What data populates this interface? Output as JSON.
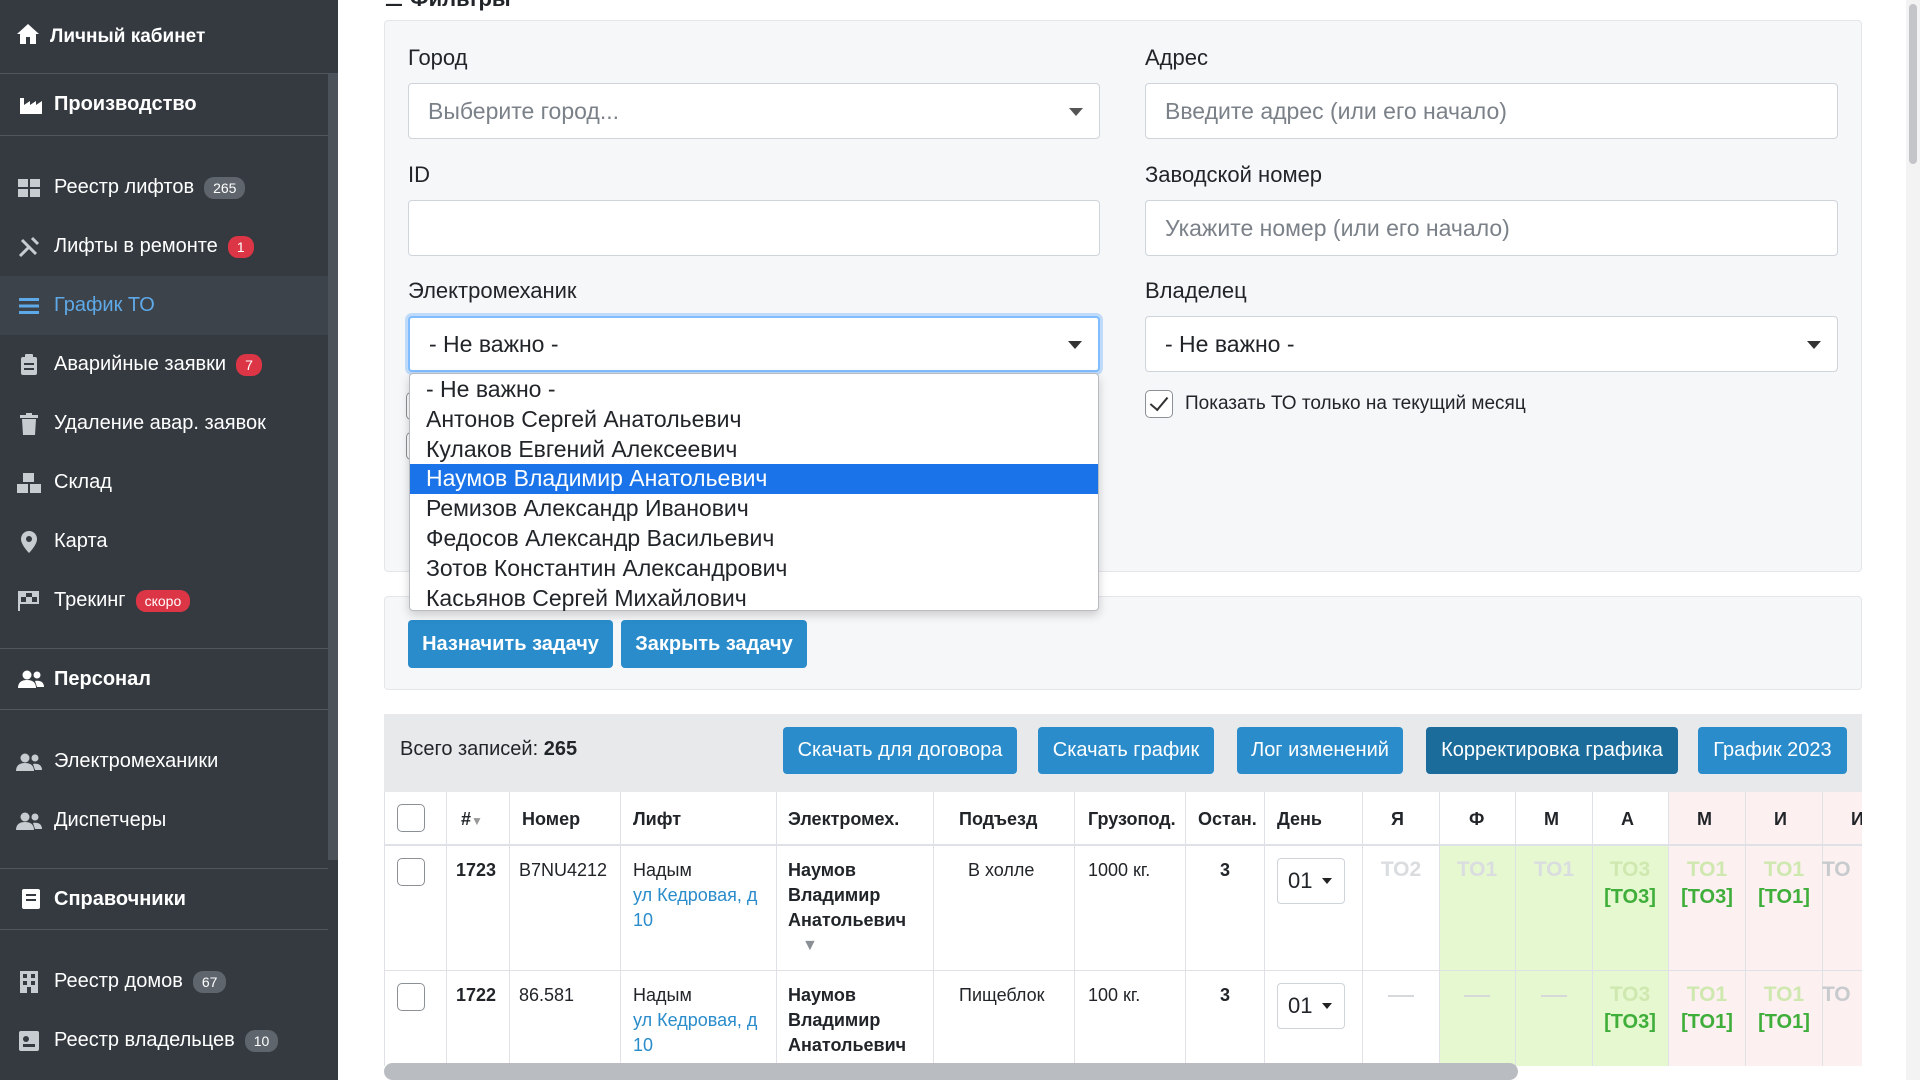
{
  "sidebar": {
    "top": {
      "label": "Личный кабинет",
      "icon": "home-icon"
    },
    "sections": [
      {
        "label": "Производство",
        "icon": "factory-icon"
      },
      {
        "label": "Персонал",
        "icon": "users-icon"
      },
      {
        "label": "Справочники",
        "icon": "book-icon"
      }
    ],
    "production_items": [
      {
        "label": "Реестр лифтов",
        "badge": "265",
        "icon": "grid-icon"
      },
      {
        "label": "Лифты в ремонте",
        "badge": "1",
        "icon": "tools-icon"
      },
      {
        "label": "График ТО",
        "badge": "",
        "icon": "bars-icon",
        "active": true
      },
      {
        "label": "Аварийные заявки",
        "badge": "7",
        "icon": "clipboard-icon"
      },
      {
        "label": "Удаление авар. заявок",
        "badge": "",
        "icon": "trash-icon"
      },
      {
        "label": "Склад",
        "badge": "",
        "icon": "boxes-icon"
      },
      {
        "label": "Карта",
        "badge": "",
        "icon": "map-pin-icon"
      },
      {
        "label": "Трекинг",
        "badge": "скоро",
        "icon": "flag-icon"
      }
    ],
    "staff_items": [
      {
        "label": "Электромеханики",
        "icon": "users-icon"
      },
      {
        "label": "Диспетчеры",
        "icon": "users-icon"
      }
    ],
    "ref_items": [
      {
        "label": "Реестр домов",
        "badge": "67",
        "icon": "building-icon"
      },
      {
        "label": "Реестр владельцев",
        "badge": "10",
        "icon": "id-card-icon"
      }
    ]
  },
  "filters": {
    "title": "Фильтры",
    "city": {
      "label": "Город",
      "placeholder": "Выберите город..."
    },
    "address": {
      "label": "Адрес",
      "placeholder": "Введите адрес (или его начало)"
    },
    "id": {
      "label": "ID",
      "value": ""
    },
    "serial": {
      "label": "Заводской номер",
      "placeholder": "Укажите номер (или его начало)"
    },
    "mechanic": {
      "label": "Электромеханик",
      "value": "- Не важно -"
    },
    "owner": {
      "label": "Владелец",
      "value": "- Не важно -"
    },
    "current_month": {
      "label": "Показать ТО только на текущий месяц",
      "checked": true
    }
  },
  "dropdown": {
    "options": [
      "- Не важно -",
      "Антонов Сергей Анатольевич",
      "Кулаков Евгений Алексеевич",
      "Наумов Владимир Анатольевич",
      "Ремизов Александр Иванович",
      "Федосов Александр Васильевич",
      "Зотов Константин Александрович",
      "Касьянов Сергей Михайлович"
    ],
    "selected_index": 3
  },
  "tasks": {
    "assign": "Назначить задачу",
    "close": "Закрыть задачу"
  },
  "toolbar": {
    "total_label": "Всего записей:",
    "total_value": "265",
    "buttons": [
      "Скачать для договора",
      "Скачать график",
      "Лог изменений",
      "Корректировка графика",
      "График 2023"
    ]
  },
  "table": {
    "headers": [
      "#",
      "Номер",
      "Лифт",
      "Электромех.",
      "Подъезд",
      "Грузопод.",
      "Остан.",
      "День",
      "Я",
      "Ф",
      "М",
      "А",
      "М",
      "И",
      "И"
    ],
    "rows": [
      {
        "id": "1723",
        "number": "B7NU4212",
        "city": "Надым",
        "street": "ул Кедровая, д",
        "house": "10",
        "mech1": "Наумов",
        "mech2": "Владимир",
        "mech3": "Анатольевич",
        "entrance": "В холле",
        "capacity": "1000 кг.",
        "stops": "3",
        "day": "01",
        "faded": [
          "ТО2",
          "ТО1",
          "ТО1"
        ],
        "green_top": [
          "ТО3",
          "ТО1",
          "ТО1"
        ],
        "green_bot": [
          "[ТО3]",
          "[ТО3]",
          "[ТО1]"
        ],
        "last": "ТО"
      },
      {
        "id": "1722",
        "number": "86.581",
        "city": "Надым",
        "street": "ул Кедровая, д",
        "house": "10",
        "mech1": "Наумов",
        "mech2": "Владимир",
        "mech3": "Анатольевич",
        "entrance": "Пищеблок",
        "capacity": "100 кг.",
        "stops": "3",
        "day": "01",
        "green_top": [
          "ТО3",
          "ТО1",
          "ТО1"
        ],
        "green_bot": [
          "[ТО3]",
          "[ТО1]",
          "[ТО1]"
        ],
        "last": "ТО"
      }
    ]
  },
  "colors": {
    "sidebar": "#343a40",
    "accent": "#2a8ccb",
    "selected": "#1a73e8",
    "green": "#3fae3a"
  }
}
